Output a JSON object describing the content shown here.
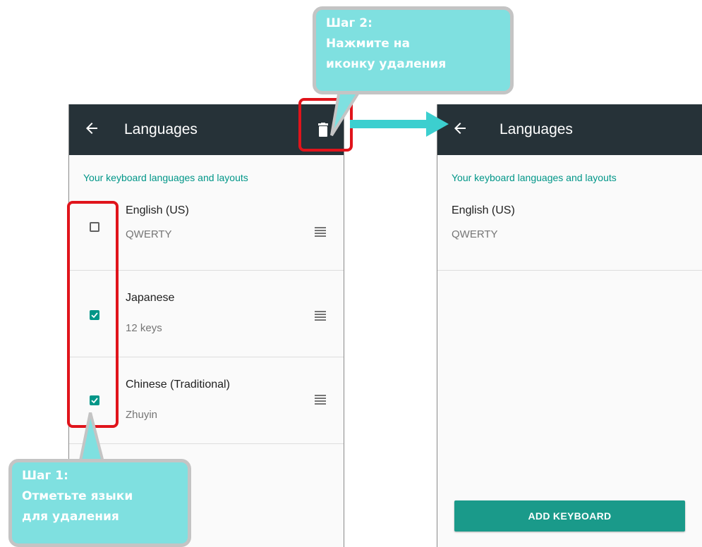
{
  "left_screen": {
    "title": "Languages",
    "section_header": "Your keyboard languages and layouts",
    "items": [
      {
        "name": "English (US)",
        "layout": "QWERTY",
        "checked": false
      },
      {
        "name": "Japanese",
        "layout": "12 keys",
        "checked": true
      },
      {
        "name": "Chinese (Traditional)",
        "layout": "Zhuyin",
        "checked": true
      }
    ]
  },
  "right_screen": {
    "title": "Languages",
    "section_header": "Your keyboard languages and layouts",
    "items": [
      {
        "name": "English (US)",
        "layout": "QWERTY"
      }
    ],
    "add_button": "ADD KEYBOARD"
  },
  "callouts": {
    "step1": {
      "line1": "Шаг 1:",
      "line2": "Отметьте языки",
      "line3": "для удаления"
    },
    "step2": {
      "line1": "Шаг 2:",
      "line2": "Нажмите на",
      "line3": "иконку удаления"
    }
  },
  "colors": {
    "appbar": "#263238",
    "accent": "#009688",
    "button": "#1a9a8a",
    "highlight": "#e0141b",
    "callout": "#7fe0e0",
    "arrow": "#3ccfcf"
  },
  "icons": {
    "back": "arrow-left-icon",
    "delete": "trash-icon",
    "drag": "drag-handle-icon",
    "checkbox": "check-icon"
  }
}
